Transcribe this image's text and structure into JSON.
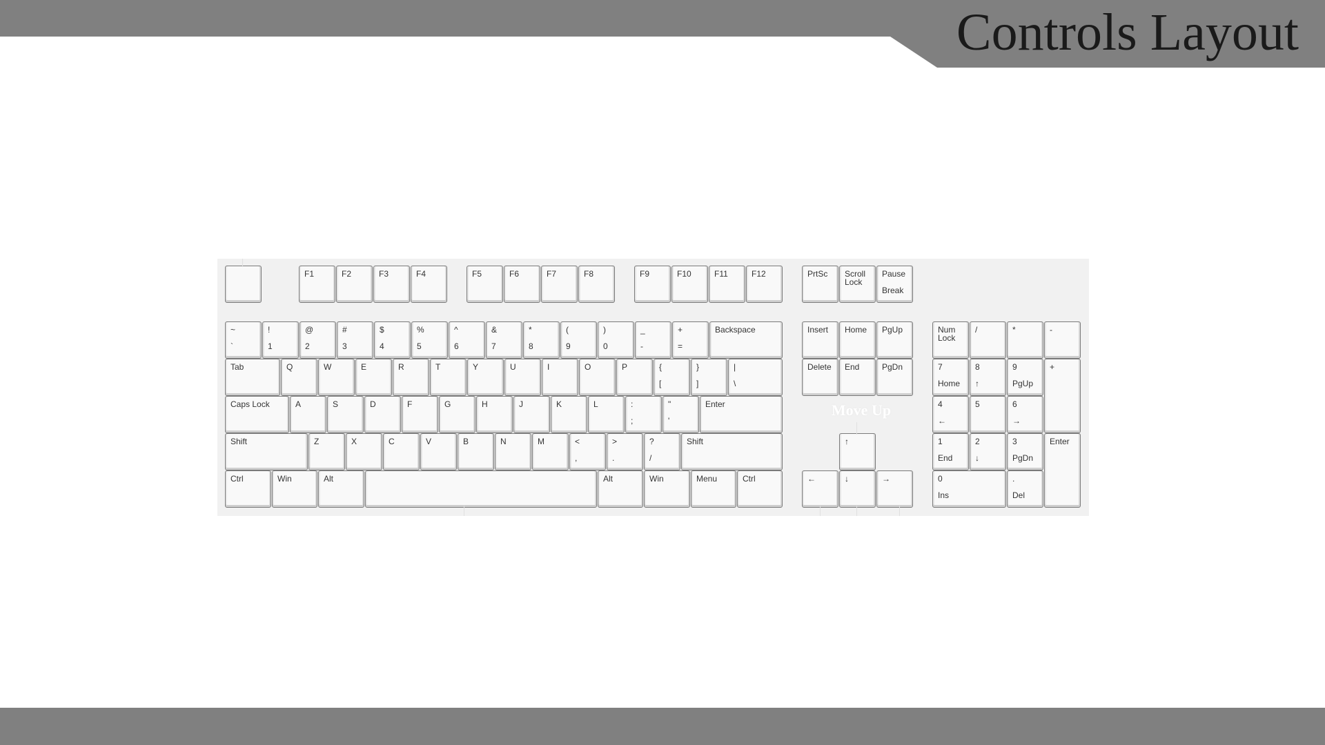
{
  "title": "Controls Layout",
  "caption": "Move Up",
  "colors": {
    "bars": "#808080",
    "panel": "#f1f1f1",
    "key_face": "#f9f9f9",
    "key_border": "#7a7a7a"
  },
  "keys": {
    "esc": {
      "top": "",
      "bottom": ""
    },
    "f1": {
      "top": "F1",
      "bottom": ""
    },
    "f2": {
      "top": "F2",
      "bottom": ""
    },
    "f3": {
      "top": "F3",
      "bottom": ""
    },
    "f4": {
      "top": "F4",
      "bottom": ""
    },
    "f5": {
      "top": "F5",
      "bottom": ""
    },
    "f6": {
      "top": "F6",
      "bottom": ""
    },
    "f7": {
      "top": "F7",
      "bottom": ""
    },
    "f8": {
      "top": "F8",
      "bottom": ""
    },
    "f9": {
      "top": "F9",
      "bottom": ""
    },
    "f10": {
      "top": "F10",
      "bottom": ""
    },
    "f11": {
      "top": "F11",
      "bottom": ""
    },
    "f12": {
      "top": "F12",
      "bottom": ""
    },
    "prtsc": {
      "top": "PrtSc",
      "bottom": ""
    },
    "scrolllock": {
      "top": "Scroll\nLock",
      "bottom": ""
    },
    "pause": {
      "top": "Pause",
      "bottom": "Break"
    },
    "tilde": {
      "top": "~",
      "bottom": "`"
    },
    "d1": {
      "top": "!",
      "bottom": "1"
    },
    "d2": {
      "top": "@",
      "bottom": "2"
    },
    "d3": {
      "top": "#",
      "bottom": "3"
    },
    "d4": {
      "top": "$",
      "bottom": "4"
    },
    "d5": {
      "top": "%",
      "bottom": "5"
    },
    "d6": {
      "top": "^",
      "bottom": "6"
    },
    "d7": {
      "top": "&",
      "bottom": "7"
    },
    "d8": {
      "top": "*",
      "bottom": "8"
    },
    "d9": {
      "top": "(",
      "bottom": "9"
    },
    "d0": {
      "top": ")",
      "bottom": "0"
    },
    "minus": {
      "top": "_",
      "bottom": "-"
    },
    "equals": {
      "top": "+",
      "bottom": "="
    },
    "backspace": {
      "top": "Backspace",
      "bottom": ""
    },
    "insert": {
      "top": "Insert",
      "bottom": ""
    },
    "home": {
      "top": "Home",
      "bottom": ""
    },
    "pgup": {
      "top": "PgUp",
      "bottom": ""
    },
    "numlock": {
      "top": "Num\nLock",
      "bottom": ""
    },
    "numslash": {
      "top": "/",
      "bottom": ""
    },
    "numstar": {
      "top": "*",
      "bottom": ""
    },
    "numminus": {
      "top": "-",
      "bottom": ""
    },
    "tab": {
      "top": "Tab",
      "bottom": ""
    },
    "q": {
      "top": "Q",
      "bottom": ""
    },
    "w": {
      "top": "W",
      "bottom": ""
    },
    "e": {
      "top": "E",
      "bottom": ""
    },
    "r": {
      "top": "R",
      "bottom": ""
    },
    "t": {
      "top": "T",
      "bottom": ""
    },
    "y": {
      "top": "Y",
      "bottom": ""
    },
    "u": {
      "top": "U",
      "bottom": ""
    },
    "i": {
      "top": "I",
      "bottom": ""
    },
    "o": {
      "top": "O",
      "bottom": ""
    },
    "p": {
      "top": "P",
      "bottom": ""
    },
    "lbracket": {
      "top": "{",
      "bottom": "["
    },
    "rbracket": {
      "top": "}",
      "bottom": "]"
    },
    "backslash": {
      "top": "|",
      "bottom": "\\"
    },
    "delete": {
      "top": "Delete",
      "bottom": ""
    },
    "end": {
      "top": "End",
      "bottom": ""
    },
    "pgdn": {
      "top": "PgDn",
      "bottom": ""
    },
    "num7": {
      "top": "7",
      "bottom": "Home"
    },
    "num8": {
      "top": "8",
      "bottom": "↑"
    },
    "num9": {
      "top": "9",
      "bottom": "PgUp"
    },
    "numplus": {
      "top": "+",
      "bottom": ""
    },
    "capslock": {
      "top": "Caps Lock",
      "bottom": ""
    },
    "a": {
      "top": "A",
      "bottom": ""
    },
    "s": {
      "top": "S",
      "bottom": ""
    },
    "d": {
      "top": "D",
      "bottom": ""
    },
    "f": {
      "top": "F",
      "bottom": ""
    },
    "g": {
      "top": "G",
      "bottom": ""
    },
    "h": {
      "top": "H",
      "bottom": ""
    },
    "j": {
      "top": "J",
      "bottom": ""
    },
    "k": {
      "top": "K",
      "bottom": ""
    },
    "l": {
      "top": "L",
      "bottom": ""
    },
    "semicolon": {
      "top": ":",
      "bottom": ";"
    },
    "quote": {
      "top": "\"",
      "bottom": "'"
    },
    "enter": {
      "top": "Enter",
      "bottom": ""
    },
    "num4": {
      "top": "4",
      "bottom": "←"
    },
    "num5": {
      "top": "5",
      "bottom": ""
    },
    "num6": {
      "top": "6",
      "bottom": "→"
    },
    "lshift": {
      "top": "Shift",
      "bottom": ""
    },
    "z": {
      "top": "Z",
      "bottom": ""
    },
    "x": {
      "top": "X",
      "bottom": ""
    },
    "c": {
      "top": "C",
      "bottom": ""
    },
    "v": {
      "top": "V",
      "bottom": ""
    },
    "b": {
      "top": "B",
      "bottom": ""
    },
    "n": {
      "top": "N",
      "bottom": ""
    },
    "m": {
      "top": "M",
      "bottom": ""
    },
    "comma": {
      "top": "<",
      "bottom": ","
    },
    "period": {
      "top": ">",
      "bottom": "."
    },
    "slash": {
      "top": "?",
      "bottom": "/"
    },
    "rshift": {
      "top": "Shift",
      "bottom": ""
    },
    "up": {
      "top": "↑",
      "bottom": ""
    },
    "num1": {
      "top": "1",
      "bottom": "End"
    },
    "num2": {
      "top": "2",
      "bottom": "↓"
    },
    "num3": {
      "top": "3",
      "bottom": "PgDn"
    },
    "numenter": {
      "top": "Enter",
      "bottom": ""
    },
    "lctrl": {
      "top": "Ctrl",
      "bottom": ""
    },
    "lwin": {
      "top": "Win",
      "bottom": ""
    },
    "lalt": {
      "top": "Alt",
      "bottom": ""
    },
    "space": {
      "top": "",
      "bottom": ""
    },
    "ralt": {
      "top": "Alt",
      "bottom": ""
    },
    "rwin": {
      "top": "Win",
      "bottom": ""
    },
    "menu": {
      "top": "Menu",
      "bottom": ""
    },
    "rctrl": {
      "top": "Ctrl",
      "bottom": ""
    },
    "left": {
      "top": "←",
      "bottom": ""
    },
    "down": {
      "top": "↓",
      "bottom": ""
    },
    "right": {
      "top": "→",
      "bottom": ""
    },
    "num0": {
      "top": "0",
      "bottom": "Ins"
    },
    "numdot": {
      "top": ".",
      "bottom": "Del"
    }
  }
}
